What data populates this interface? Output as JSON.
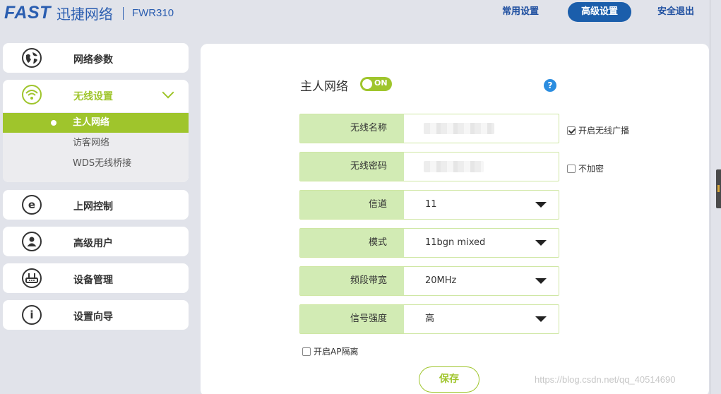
{
  "header": {
    "brand": "FAST",
    "brand_cn": "迅捷网络",
    "model": "FWR310",
    "nav": {
      "common": "常用设置",
      "advanced": "高级设置",
      "logout": "安全退出"
    }
  },
  "sidebar": {
    "network_params": {
      "label": "网络参数",
      "icon": "globe-icon"
    },
    "wireless": {
      "label": "无线设置",
      "icon": "wifi-icon",
      "subitems": [
        "主人网络",
        "访客网络",
        "WDS无线桥接"
      ]
    },
    "internet_control": {
      "label": "上网控制",
      "icon": "e-icon",
      "glyph": "e"
    },
    "advanced_users": {
      "label": "高级用户",
      "icon": "user-icon"
    },
    "device_mgmt": {
      "label": "设备管理",
      "icon": "router-icon"
    },
    "setup_wizard": {
      "label": "设置向导",
      "icon": "info-icon",
      "glyph": "i"
    }
  },
  "main": {
    "title": "主人网络",
    "toggle": "ON",
    "help": "?",
    "fields": {
      "ssid": {
        "label": "无线名称"
      },
      "password": {
        "label": "无线密码"
      },
      "channel": {
        "label": "信道",
        "value": "11"
      },
      "mode": {
        "label": "模式",
        "value": "11bgn mixed"
      },
      "bandwidth": {
        "label": "频段带宽",
        "value": "20MHz"
      },
      "signal": {
        "label": "信号强度",
        "value": "高"
      }
    },
    "broadcast": {
      "label": "开启无线广播",
      "checked": true
    },
    "no_encrypt": {
      "label": "不加密",
      "checked": false
    },
    "ap_isolation": {
      "label": "开启AP隔离",
      "checked": false
    },
    "save": "保存"
  },
  "watermark": "https://blog.csdn.net/qq_40514690",
  "colors": {
    "accent": "#9fc52c",
    "brand": "#2a5db0",
    "nav_active": "#1b5eab",
    "field_label_bg": "#d2ebb4"
  }
}
